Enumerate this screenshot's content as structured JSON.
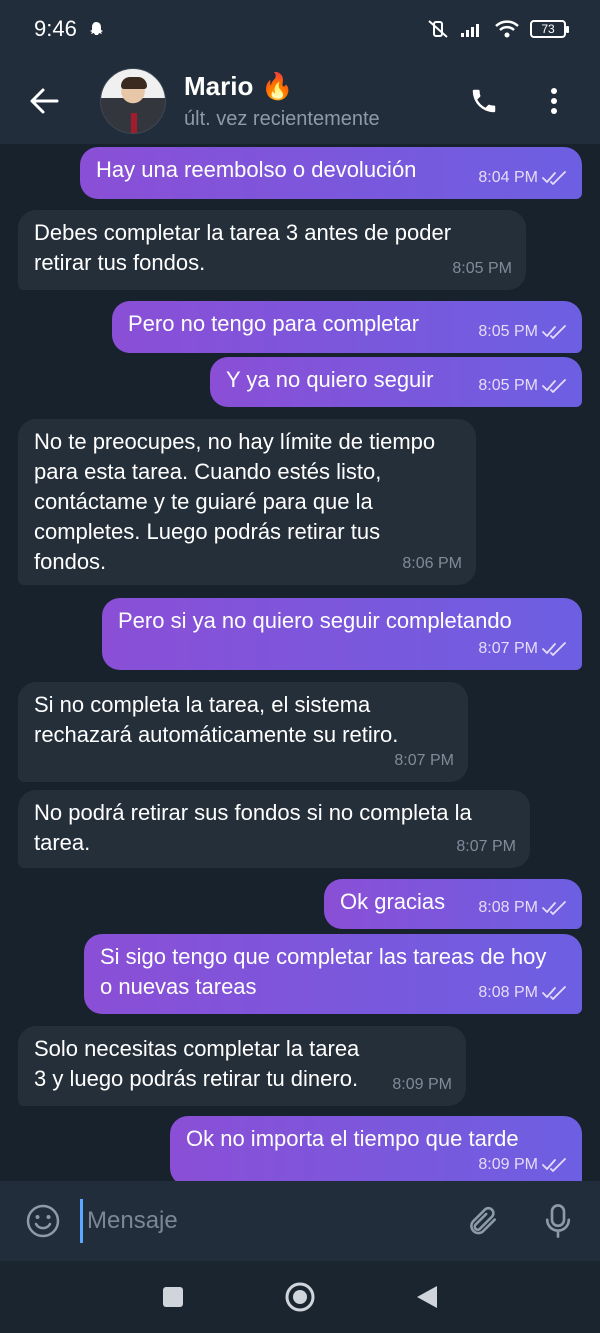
{
  "status_bar": {
    "time": "9:46",
    "battery": "73"
  },
  "header": {
    "contact_name": "Mario",
    "contact_status": "últ. vez recientemente",
    "name_emoji": "🔥"
  },
  "messages": [
    {
      "direction": "out",
      "text": "Hay una reembolso o devolución",
      "time": "8:04 PM"
    },
    {
      "direction": "in",
      "text": "Debes completar la tarea 3 antes de poder retirar tus fondos.",
      "time": "8:05 PM"
    },
    {
      "direction": "out",
      "text": "Pero no tengo para completar",
      "time": "8:05 PM"
    },
    {
      "direction": "out",
      "text": "Y ya no quiero seguir",
      "time": "8:05 PM"
    },
    {
      "direction": "in",
      "text": "No te preocupes, no hay límite de tiempo para esta tarea. Cuando estés listo, contáctame y te guiaré para que la completes. Luego podrás retirar tus fondos.",
      "time": "8:06 PM"
    },
    {
      "direction": "out",
      "text": "Pero si ya no quiero seguir completando",
      "time": "8:07 PM"
    },
    {
      "direction": "in",
      "text": "Si no completa la tarea, el sistema rechazará automáticamente su retiro.",
      "time": "8:07 PM"
    },
    {
      "direction": "in",
      "text": "No podrá retirar sus fondos si no completa la tarea.",
      "time": "8:07 PM"
    },
    {
      "direction": "out",
      "text": "Ok gracias",
      "time": "8:08 PM"
    },
    {
      "direction": "out",
      "text": "Si sigo tengo que completar las tareas de hoy o nuevas tareas",
      "time": "8:08 PM"
    },
    {
      "direction": "in",
      "text": "Solo necesitas completar la tarea 3 y luego podrás retirar tu dinero.",
      "time": "8:09 PM"
    },
    {
      "direction": "out",
      "text": "Ok no importa el tiempo que tarde",
      "time": "8:09 PM"
    }
  ],
  "input": {
    "placeholder": "Mensaje"
  },
  "icons": {
    "back": "back-arrow-icon",
    "call": "phone-icon",
    "menu": "more-vertical-icon",
    "emoji": "emoji-icon",
    "attach": "paperclip-icon",
    "mic": "microphone-icon"
  },
  "colors": {
    "outgoing_bubble": "#8a4fd6",
    "incoming_bubble": "#252f3a",
    "header_bg": "#212d3b",
    "chat_bg": "#18222d"
  }
}
